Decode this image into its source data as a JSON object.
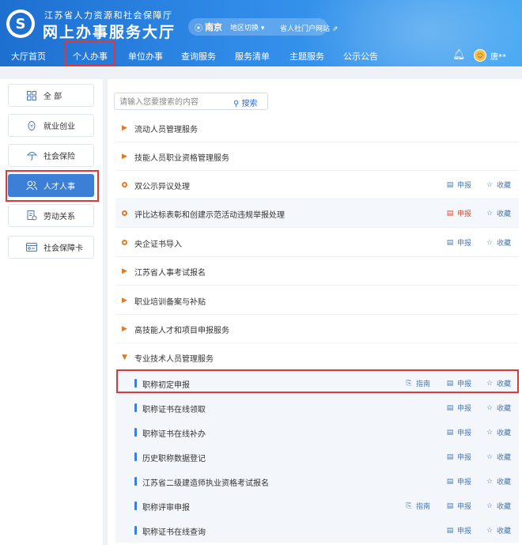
{
  "header": {
    "org_sub": "江苏省人力资源和社会保障厅",
    "org_main": "网上办事服务大厅",
    "city": "南京",
    "switch_label": "地区切换",
    "portal_label": "省人社门户网站",
    "username": "唐**",
    "brand_color": "#1e6fd0"
  },
  "nav": {
    "items": [
      "大厅首页",
      "个人办事",
      "单位办事",
      "查询服务",
      "服务清单",
      "主题服务",
      "公示公告"
    ],
    "active": "个人办事"
  },
  "sidebar": {
    "items": [
      {
        "label": "全 部",
        "icon": "grid-icon"
      },
      {
        "label": "就业创业",
        "icon": "coin-icon"
      },
      {
        "label": "社会保险",
        "icon": "umbrella-icon"
      },
      {
        "label": "人才人事",
        "icon": "people-icon"
      },
      {
        "label": "劳动关系",
        "icon": "document-icon"
      },
      {
        "label": "社会保障卡",
        "icon": "card-icon"
      }
    ],
    "active": "人才人事",
    "active_color": "#3b7fd6"
  },
  "search": {
    "placeholder": "请输入您要搜索的内容",
    "button": "搜索"
  },
  "services": [
    {
      "title": "流动人员管理服务",
      "type": "category"
    },
    {
      "title": "技能人员职业资格管理服务",
      "type": "category"
    },
    {
      "title": "双公示异议处理",
      "type": "item",
      "apply": "申报",
      "favorite": "收藏"
    },
    {
      "title": "评比达标表彰和创建示范活动违规举报处理",
      "type": "item",
      "apply": "申报",
      "favorite": "收藏"
    },
    {
      "title": "央企证书导入",
      "type": "item",
      "apply": "申报",
      "favorite": "收藏"
    },
    {
      "title": "江苏省人事考试报名",
      "type": "category"
    },
    {
      "title": "职业培训备案与补贴",
      "type": "category"
    },
    {
      "title": "高技能人才和项目申报服务",
      "type": "category"
    },
    {
      "title": "专业技术人员管理服务",
      "type": "category",
      "expanded": true
    }
  ],
  "sub_services": [
    {
      "title": "职称初定申报",
      "guide": "指南",
      "apply": "申报",
      "favorite": "收藏"
    },
    {
      "title": "职称证书在线领取",
      "apply": "申报",
      "favorite": "收藏"
    },
    {
      "title": "职称证书在线补办",
      "apply": "申报",
      "favorite": "收藏"
    },
    {
      "title": "历史职称数据登记",
      "apply": "申报",
      "favorite": "收藏"
    },
    {
      "title": "江苏省二级建造师执业资格考试报名",
      "apply": "申报",
      "favorite": "收藏"
    },
    {
      "title": "职称评审申报",
      "guide": "指南",
      "apply": "申报",
      "favorite": "收藏"
    },
    {
      "title": "职称证书在线查询",
      "apply": "申报",
      "favorite": "收藏"
    }
  ],
  "colors": {
    "highlight": "#d93a3a",
    "marker": "#e07a27",
    "action": "#4a79b4"
  }
}
